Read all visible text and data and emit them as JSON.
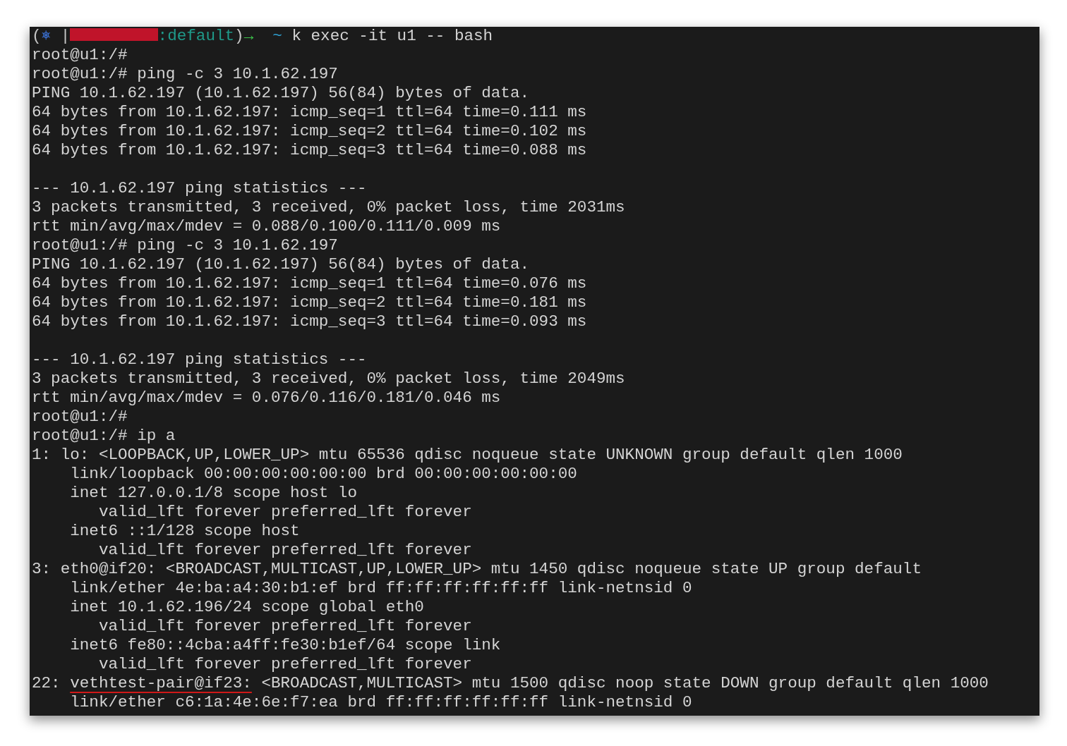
{
  "terminal": {
    "lines": [
      {
        "kind": "segments",
        "segments": [
          {
            "kind": "text",
            "text": "(",
            "color": "#c8c8c8"
          },
          {
            "kind": "text",
            "text": "⎈",
            "color": "#3a6fd0"
          },
          {
            "kind": "text",
            "text": " |",
            "color": "#c8c8c8"
          },
          {
            "kind": "redacted",
            "color": "#c0142a"
          },
          {
            "kind": "text",
            "text": ":default",
            "color": "#1f9a8a"
          },
          {
            "kind": "text",
            "text": ")",
            "color": "#c8c8c8"
          },
          {
            "kind": "text",
            "text": "→",
            "color": "#3cc24a"
          },
          {
            "kind": "text",
            "text": "  ~",
            "color": "#2f9fd0"
          },
          {
            "kind": "text",
            "text": " k exec -it u1 -- bash",
            "color": "#d4d4d4"
          }
        ]
      },
      {
        "kind": "text",
        "text": "root@u1:/#"
      },
      {
        "kind": "text",
        "text": "root@u1:/# ping -c 3 10.1.62.197"
      },
      {
        "kind": "text",
        "text": "PING 10.1.62.197 (10.1.62.197) 56(84) bytes of data."
      },
      {
        "kind": "text",
        "text": "64 bytes from 10.1.62.197: icmp_seq=1 ttl=64 time=0.111 ms"
      },
      {
        "kind": "text",
        "text": "64 bytes from 10.1.62.197: icmp_seq=2 ttl=64 time=0.102 ms"
      },
      {
        "kind": "text",
        "text": "64 bytes from 10.1.62.197: icmp_seq=3 ttl=64 time=0.088 ms"
      },
      {
        "kind": "blank"
      },
      {
        "kind": "text",
        "text": "--- 10.1.62.197 ping statistics ---"
      },
      {
        "kind": "text",
        "text": "3 packets transmitted, 3 received, 0% packet loss, time 2031ms"
      },
      {
        "kind": "text",
        "text": "rtt min/avg/max/mdev = 0.088/0.100/0.111/0.009 ms"
      },
      {
        "kind": "text",
        "text": "root@u1:/# ping -c 3 10.1.62.197"
      },
      {
        "kind": "text",
        "text": "PING 10.1.62.197 (10.1.62.197) 56(84) bytes of data."
      },
      {
        "kind": "text",
        "text": "64 bytes from 10.1.62.197: icmp_seq=1 ttl=64 time=0.076 ms"
      },
      {
        "kind": "text",
        "text": "64 bytes from 10.1.62.197: icmp_seq=2 ttl=64 time=0.181 ms"
      },
      {
        "kind": "text",
        "text": "64 bytes from 10.1.62.197: icmp_seq=3 ttl=64 time=0.093 ms"
      },
      {
        "kind": "blank"
      },
      {
        "kind": "text",
        "text": "--- 10.1.62.197 ping statistics ---"
      },
      {
        "kind": "text",
        "text": "3 packets transmitted, 3 received, 0% packet loss, time 2049ms"
      },
      {
        "kind": "text",
        "text": "rtt min/avg/max/mdev = 0.076/0.116/0.181/0.046 ms"
      },
      {
        "kind": "text",
        "text": "root@u1:/#"
      },
      {
        "kind": "text",
        "text": "root@u1:/# ip a"
      },
      {
        "kind": "text",
        "text": "1: lo: <LOOPBACK,UP,LOWER_UP> mtu 65536 qdisc noqueue state UNKNOWN group default qlen 1000"
      },
      {
        "kind": "text",
        "text": "    link/loopback 00:00:00:00:00:00 brd 00:00:00:00:00:00"
      },
      {
        "kind": "text",
        "text": "    inet 127.0.0.1/8 scope host lo"
      },
      {
        "kind": "text",
        "text": "       valid_lft forever preferred_lft forever"
      },
      {
        "kind": "text",
        "text": "    inet6 ::1/128 scope host"
      },
      {
        "kind": "text",
        "text": "       valid_lft forever preferred_lft forever"
      },
      {
        "kind": "text",
        "text": "3: eth0@if20: <BROADCAST,MULTICAST,UP,LOWER_UP> mtu 1450 qdisc noqueue state UP group default"
      },
      {
        "kind": "text",
        "text": "    link/ether 4e:ba:a4:30:b1:ef brd ff:ff:ff:ff:ff:ff link-netnsid 0"
      },
      {
        "kind": "text",
        "text": "    inet 10.1.62.196/24 scope global eth0"
      },
      {
        "kind": "text",
        "text": "       valid_lft forever preferred_lft forever"
      },
      {
        "kind": "text",
        "text": "    inet6 fe80::4cba:a4ff:fe30:b1ef/64 scope link"
      },
      {
        "kind": "text",
        "text": "       valid_lft forever preferred_lft forever"
      },
      {
        "kind": "segments",
        "segments": [
          {
            "kind": "text",
            "text": "22: "
          },
          {
            "kind": "underlined",
            "text": "vethtest-pair@if23:",
            "color": "#d01818"
          },
          {
            "kind": "text",
            "text": " <BROADCAST,MULTICAST> mtu 1500 qdisc noop state DOWN group default qlen 1000"
          }
        ]
      },
      {
        "kind": "text",
        "text": "    link/ether c6:1a:4e:6e:f7:ea brd ff:ff:ff:ff:ff:ff link-netnsid 0"
      }
    ]
  }
}
